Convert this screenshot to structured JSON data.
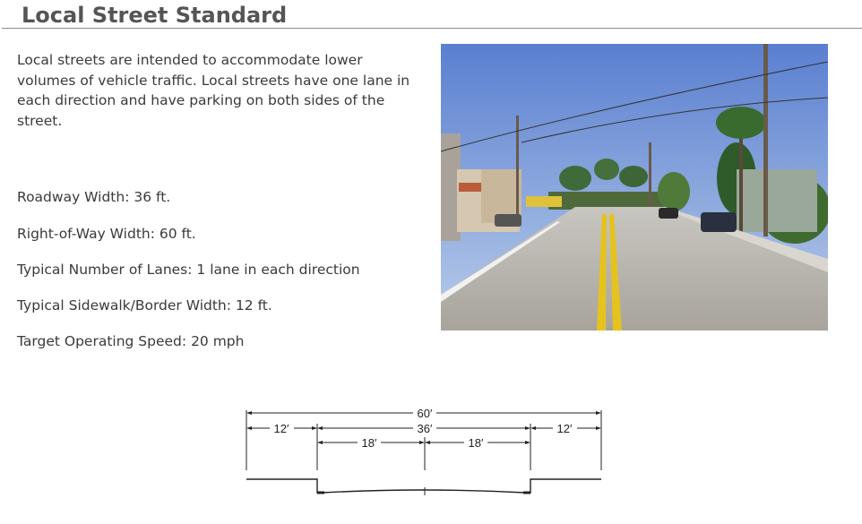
{
  "header": {
    "title": "Local Street Standard"
  },
  "intro": "Local streets are intended to accommodate lower volumes of vehicle traffic. Local streets have one lane in each direction and have parking on both sides of the street.",
  "specs": [
    {
      "label": "Roadway Width:",
      "value": "36 ft."
    },
    {
      "label": "Right-of-Way Width:",
      "value": "60 ft."
    },
    {
      "label": "Typical Number of Lanes:",
      "value": "1 lane in each direction"
    },
    {
      "label": "Typical Sidewalk/Border Width:",
      "value": "12 ft."
    },
    {
      "label": "Target Operating Speed:",
      "value": "20 mph"
    }
  ],
  "diagram": {
    "right_of_way": "60′",
    "roadway": "36′",
    "sidewalk_left": "12′",
    "sidewalk_right": "12′",
    "lane_left": "18′",
    "lane_right": "18′"
  },
  "colors": {
    "title": "#555555",
    "body_text": "#3a3a3a",
    "sky": "#6f8fd6",
    "asphalt": "#b9b6ae",
    "center_line": "#e6c21e"
  }
}
